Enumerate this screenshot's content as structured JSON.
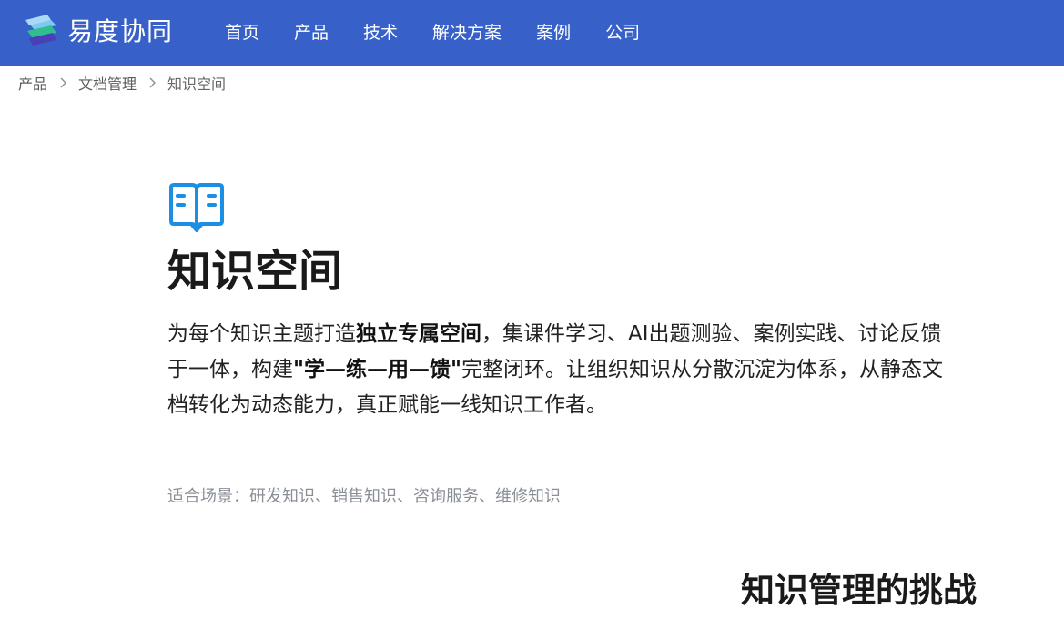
{
  "header": {
    "logo_text": "易度协同",
    "nav": [
      "首页",
      "产品",
      "技术",
      "解决方案",
      "案例",
      "公司"
    ]
  },
  "breadcrumb": {
    "items": [
      "产品",
      "文档管理"
    ],
    "current": "知识空间"
  },
  "hero": {
    "icon": "open-book-icon",
    "title": "知识空间",
    "desc": {
      "p1": "为每个知识主题打造",
      "b1": "独立专属空间",
      "p2": "，集课件学习、AI出题测验、案例实践、讨论反馈于一体，构建",
      "b2": "\"学—练—用—馈\"",
      "p3": "完整闭环。让组织知识从分散沉淀为体系，从静态文档转化为动态能力，真正赋能一线知识工作者。"
    },
    "scene": "适合场景：研发知识、销售知识、咨询服务、维修知识"
  },
  "section": {
    "title": "知识管理的挑战"
  },
  "colors": {
    "header_bg": "#3761c8",
    "icon_blue": "#1a8fe3",
    "muted_text": "#8a8f96"
  }
}
